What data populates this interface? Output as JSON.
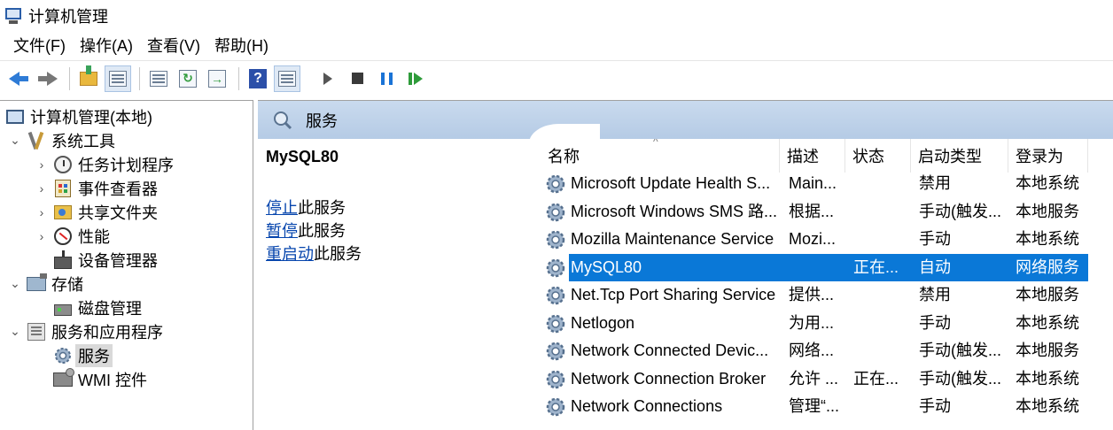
{
  "window": {
    "title": "计算机管理"
  },
  "menu": [
    "文件(F)",
    "操作(A)",
    "查看(V)",
    "帮助(H)"
  ],
  "toolbar": {
    "help_glyph": "?"
  },
  "tree": {
    "root": "计算机管理(本地)",
    "items": [
      {
        "label": "系统工具"
      },
      {
        "label": "任务计划程序"
      },
      {
        "label": "事件查看器"
      },
      {
        "label": "共享文件夹"
      },
      {
        "label": "性能"
      },
      {
        "label": "设备管理器"
      },
      {
        "label": "存储"
      },
      {
        "label": "磁盘管理"
      },
      {
        "label": "服务和应用程序"
      },
      {
        "label": "服务"
      },
      {
        "label": "WMI 控件"
      }
    ]
  },
  "panel": {
    "title": "服务"
  },
  "details": {
    "service_name": "MySQL80",
    "actions": [
      {
        "link": "停止",
        "suffix": "此服务"
      },
      {
        "link": "暂停",
        "suffix": "此服务"
      },
      {
        "link": "重启动",
        "suffix": "此服务"
      }
    ]
  },
  "services": {
    "columns": [
      "名称",
      "描述",
      "状态",
      "启动类型",
      "登录为"
    ],
    "rows": [
      {
        "name": "Microsoft Update Health S...",
        "desc": "Main...",
        "status": "",
        "startup": "禁用",
        "logon": "本地系统"
      },
      {
        "name": "Microsoft Windows SMS 路...",
        "desc": "根据...",
        "status": "",
        "startup": "手动(触发...",
        "logon": "本地服务"
      },
      {
        "name": "Mozilla Maintenance Service",
        "desc": "Mozi...",
        "status": "",
        "startup": "手动",
        "logon": "本地系统"
      },
      {
        "name": "MySQL80",
        "desc": "",
        "status": "正在...",
        "startup": "自动",
        "logon": "网络服务"
      },
      {
        "name": "Net.Tcp Port Sharing Service",
        "desc": "提供...",
        "status": "",
        "startup": "禁用",
        "logon": "本地服务"
      },
      {
        "name": "Netlogon",
        "desc": "为用...",
        "status": "",
        "startup": "手动",
        "logon": "本地系统"
      },
      {
        "name": "Network Connected Devic...",
        "desc": "网络...",
        "status": "",
        "startup": "手动(触发...",
        "logon": "本地服务"
      },
      {
        "name": "Network Connection Broker",
        "desc": "允许 ...",
        "status": "正在...",
        "startup": "手动(触发...",
        "logon": "本地系统"
      },
      {
        "name": "Network Connections",
        "desc": "管理“...",
        "status": "",
        "startup": "手动",
        "logon": "本地系统"
      }
    ]
  },
  "colors": {
    "selection": "#0a78d7",
    "header_band": "#c4d7ee",
    "link": "#0645ad"
  }
}
